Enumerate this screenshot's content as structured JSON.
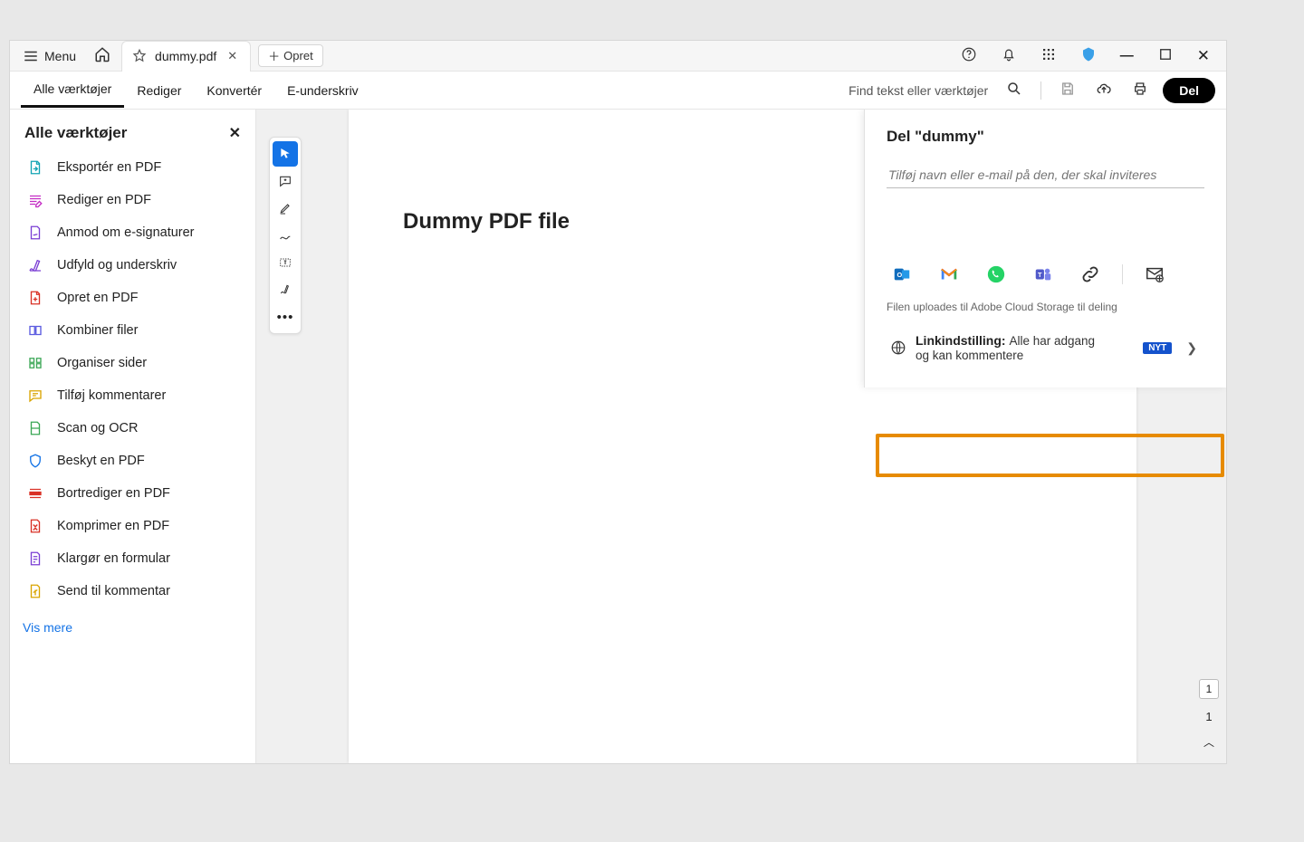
{
  "titlebar": {
    "menu_label": "Menu",
    "tab_filename": "dummy.pdf",
    "new_tab_label": "Opret"
  },
  "toolbar": {
    "tabs": [
      "Alle værktøjer",
      "Rediger",
      "Konvertér",
      "E-underskriv"
    ],
    "search_placeholder": "Find tekst eller værktøjer",
    "share_label": "Del"
  },
  "sidebar": {
    "title": "Alle værktøjer",
    "items": [
      "Eksportér en PDF",
      "Rediger en PDF",
      "Anmod om e-signaturer",
      "Udfyld og underskriv",
      "Opret en PDF",
      "Kombiner filer",
      "Organiser sider",
      "Tilføj kommentarer",
      "Scan og OCR",
      "Beskyt en PDF",
      "Bortrediger en PDF",
      "Komprimer en PDF",
      "Klargør en formular",
      "Send til kommentar"
    ],
    "show_more": "Vis mere"
  },
  "document": {
    "heading": "Dummy PDF file"
  },
  "page_counter": {
    "current": "1",
    "total": "1"
  },
  "share_panel": {
    "title": "Del \"dummy\"",
    "input_placeholder": "Tilføj navn eller e-mail på den, der skal inviteres",
    "upload_note": "Filen uploades til Adobe Cloud Storage til deling",
    "link_label": "Linkindstilling:",
    "link_desc": "Alle har adgang og kan kommentere",
    "badge": "NYT",
    "share_icons": [
      "outlook-icon",
      "gmail-icon",
      "whatsapp-icon",
      "teams-icon",
      "link-icon",
      "mail-settings-icon"
    ]
  }
}
